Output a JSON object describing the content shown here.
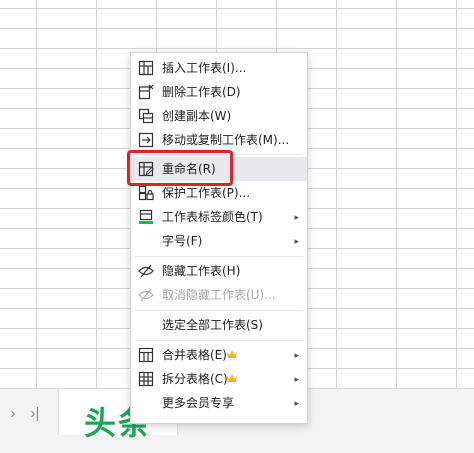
{
  "context_menu": {
    "items": [
      {
        "label": "插入工作表(I)...",
        "icon": "insert-sheet-icon"
      },
      {
        "label": "删除工作表(D)",
        "icon": "delete-sheet-icon"
      },
      {
        "label": "创建副本(W)",
        "icon": "copy-sheet-icon"
      },
      {
        "label": "移动或复制工作表(M)...",
        "icon": "move-sheet-icon"
      },
      {
        "label": "重命名(R)",
        "icon": "rename-icon",
        "highlighted": true
      },
      {
        "label": "保护工作表(P)...",
        "icon": "protect-sheet-icon"
      },
      {
        "label": "工作表标签颜色(T)",
        "icon": "tab-color-icon",
        "submenu": true
      },
      {
        "label": "字号(F)",
        "submenu": true
      },
      {
        "label": "隐藏工作表(H)",
        "icon": "hide-icon"
      },
      {
        "label": "取消隐藏工作表(U)...",
        "icon": "unhide-icon",
        "disabled": true
      },
      {
        "label": "选定全部工作表(S)"
      },
      {
        "label": "合并表格(E)",
        "icon": "merge-table-icon",
        "premium": true,
        "submenu": true
      },
      {
        "label": "拆分表格(C)",
        "icon": "split-table-icon",
        "premium": true,
        "submenu": true
      },
      {
        "label": "更多会员专享",
        "submenu": true
      }
    ],
    "submenu_arrow": "▸"
  },
  "tabbar": {
    "next_label": "›",
    "last_label": "›|"
  },
  "watermark": "头条",
  "colors": {
    "highlight_box": "#e0222b",
    "crown": "#f2b134",
    "watermark": "#1fa55b",
    "tab_color_bar": "#2eaa5b"
  }
}
